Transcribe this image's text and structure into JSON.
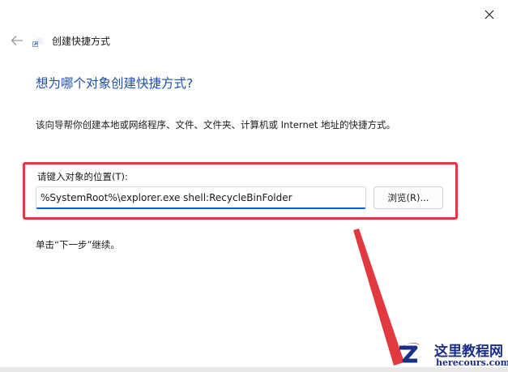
{
  "window": {
    "title": "创建快捷方式"
  },
  "icons": {
    "close": "close-icon",
    "back": "back-arrow-icon",
    "app": "shortcut-icon"
  },
  "main": {
    "heading": "想为哪个对象创建快捷方式?",
    "description": "该向导帮你创建本地或网络程序、文件、文件夹、计算机或 Internet 地址的快捷方式。"
  },
  "location": {
    "label": "请键入对象的位置(T):",
    "value": "%SystemRoot%\\explorer.exe shell:RecycleBinFolder",
    "browse_label": "浏览(R)..."
  },
  "hint": "单击“下一步”继续。",
  "watermark": {
    "title": "这里教程网",
    "url": "herecours.com"
  },
  "colors": {
    "accent": "#0a5ec6",
    "heading": "#1f4fa6",
    "highlight": "#e1393f",
    "watermark": "#1a2f86"
  }
}
